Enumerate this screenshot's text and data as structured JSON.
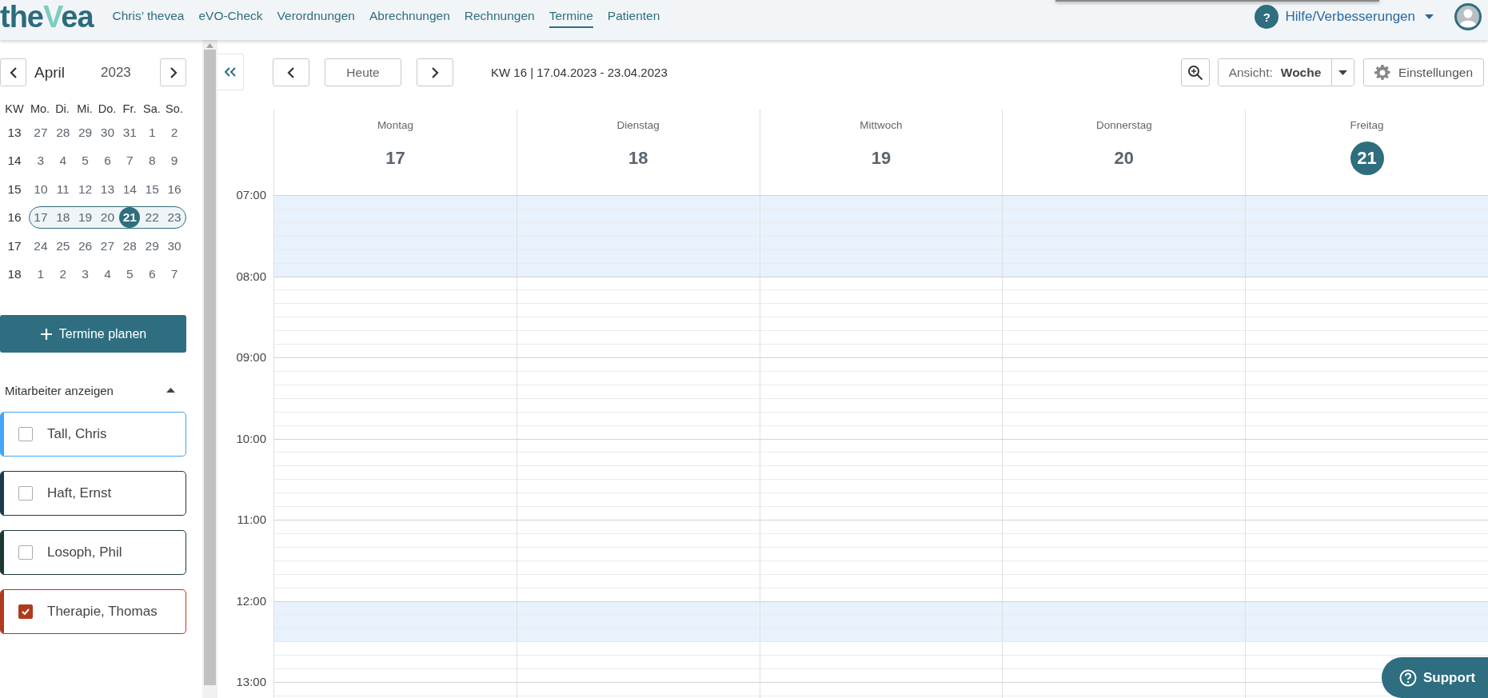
{
  "topbar": {
    "logo_parts": [
      "the",
      "V",
      "ea"
    ],
    "nav": [
      {
        "label": "Chris’ thevea",
        "selected": false
      },
      {
        "label": "eVO-Check",
        "selected": false
      },
      {
        "label": "Verordnungen",
        "selected": false
      },
      {
        "label": "Abrechnungen",
        "selected": false
      },
      {
        "label": "Rechnungen",
        "selected": false
      },
      {
        "label": "Termine",
        "selected": true
      },
      {
        "label": "Patienten",
        "selected": false
      }
    ],
    "help_icon": "?",
    "help_label": "Hilfe/Verbesserungen"
  },
  "mini_calendar": {
    "month": "April",
    "year": "2023",
    "header": [
      "KW",
      "Mo.",
      "Di.",
      "Mi.",
      "Do.",
      "Fr.",
      "Sa.",
      "So."
    ],
    "weeks": [
      {
        "kw": "13",
        "selected": false,
        "days": [
          {
            "day": "27",
            "selected": false
          },
          {
            "day": "28",
            "selected": false
          },
          {
            "day": "29",
            "selected": false
          },
          {
            "day": "30",
            "selected": false
          },
          {
            "day": "31",
            "selected": false
          },
          {
            "day": "1",
            "selected": false
          },
          {
            "day": "2",
            "selected": false
          }
        ]
      },
      {
        "kw": "14",
        "selected": false,
        "days": [
          {
            "day": "3",
            "selected": false
          },
          {
            "day": "4",
            "selected": false
          },
          {
            "day": "5",
            "selected": false
          },
          {
            "day": "6",
            "selected": false
          },
          {
            "day": "7",
            "selected": false
          },
          {
            "day": "8",
            "selected": false
          },
          {
            "day": "9",
            "selected": false
          }
        ]
      },
      {
        "kw": "15",
        "selected": false,
        "days": [
          {
            "day": "10",
            "selected": false
          },
          {
            "day": "11",
            "selected": false
          },
          {
            "day": "12",
            "selected": false
          },
          {
            "day": "13",
            "selected": false
          },
          {
            "day": "14",
            "selected": false
          },
          {
            "day": "15",
            "selected": false
          },
          {
            "day": "16",
            "selected": false
          }
        ]
      },
      {
        "kw": "16",
        "selected": true,
        "days": [
          {
            "day": "17",
            "selected": false
          },
          {
            "day": "18",
            "selected": false
          },
          {
            "day": "19",
            "selected": false
          },
          {
            "day": "20",
            "selected": false
          },
          {
            "day": "21",
            "selected": true
          },
          {
            "day": "22",
            "selected": false
          },
          {
            "day": "23",
            "selected": false
          }
        ]
      },
      {
        "kw": "17",
        "selected": false,
        "days": [
          {
            "day": "24",
            "selected": false
          },
          {
            "day": "25",
            "selected": false
          },
          {
            "day": "26",
            "selected": false
          },
          {
            "day": "27",
            "selected": false
          },
          {
            "day": "28",
            "selected": false
          },
          {
            "day": "29",
            "selected": false
          },
          {
            "day": "30",
            "selected": false
          }
        ]
      },
      {
        "kw": "18",
        "selected": false,
        "days": [
          {
            "day": "1",
            "selected": false
          },
          {
            "day": "2",
            "selected": false
          },
          {
            "day": "3",
            "selected": false
          },
          {
            "day": "4",
            "selected": false
          },
          {
            "day": "5",
            "selected": false
          },
          {
            "day": "6",
            "selected": false
          },
          {
            "day": "7",
            "selected": false
          }
        ]
      }
    ]
  },
  "plan_button": "Termine planen",
  "staff": {
    "title": "Mitarbeiter anzeigen",
    "expanded": true,
    "items": [
      {
        "name": "Tall, Chris",
        "checked": false,
        "color": "#42a5f5"
      },
      {
        "name": "Haft, Ernst",
        "checked": false,
        "color": "#1b3a4b"
      },
      {
        "name": "Losoph, Phil",
        "checked": false,
        "color": "#1c3835"
      },
      {
        "name": "Therapie, Thomas",
        "checked": true,
        "color": "#b23a1c"
      }
    ]
  },
  "toolbar": {
    "today": "Heute",
    "range": "KW 16 | 17.04.2023 - 23.04.2023",
    "view_label": "Ansicht:",
    "view_value": "Woche",
    "settings": "Einstellungen"
  },
  "week": {
    "days": [
      {
        "name": "Montag",
        "date": "17",
        "today": false
      },
      {
        "name": "Dienstag",
        "date": "18",
        "today": false
      },
      {
        "name": "Mittwoch",
        "date": "19",
        "today": false
      },
      {
        "name": "Donnerstag",
        "date": "20",
        "today": false
      },
      {
        "name": "Freitag",
        "date": "21",
        "today": true
      }
    ],
    "hours": [
      {
        "label": "07:00",
        "first_half_shaded": true,
        "second_half_shaded": true
      },
      {
        "label": "08:00",
        "first_half_shaded": false,
        "second_half_shaded": false
      },
      {
        "label": "09:00",
        "first_half_shaded": false,
        "second_half_shaded": false
      },
      {
        "label": "10:00",
        "first_half_shaded": false,
        "second_half_shaded": false
      },
      {
        "label": "11:00",
        "first_half_shaded": false,
        "second_half_shaded": false
      },
      {
        "label": "12:00",
        "first_half_shaded": true,
        "second_half_shaded": false
      },
      {
        "label": "13:00",
        "first_half_shaded": false,
        "second_half_shaded": false
      }
    ]
  },
  "support": "Support"
}
